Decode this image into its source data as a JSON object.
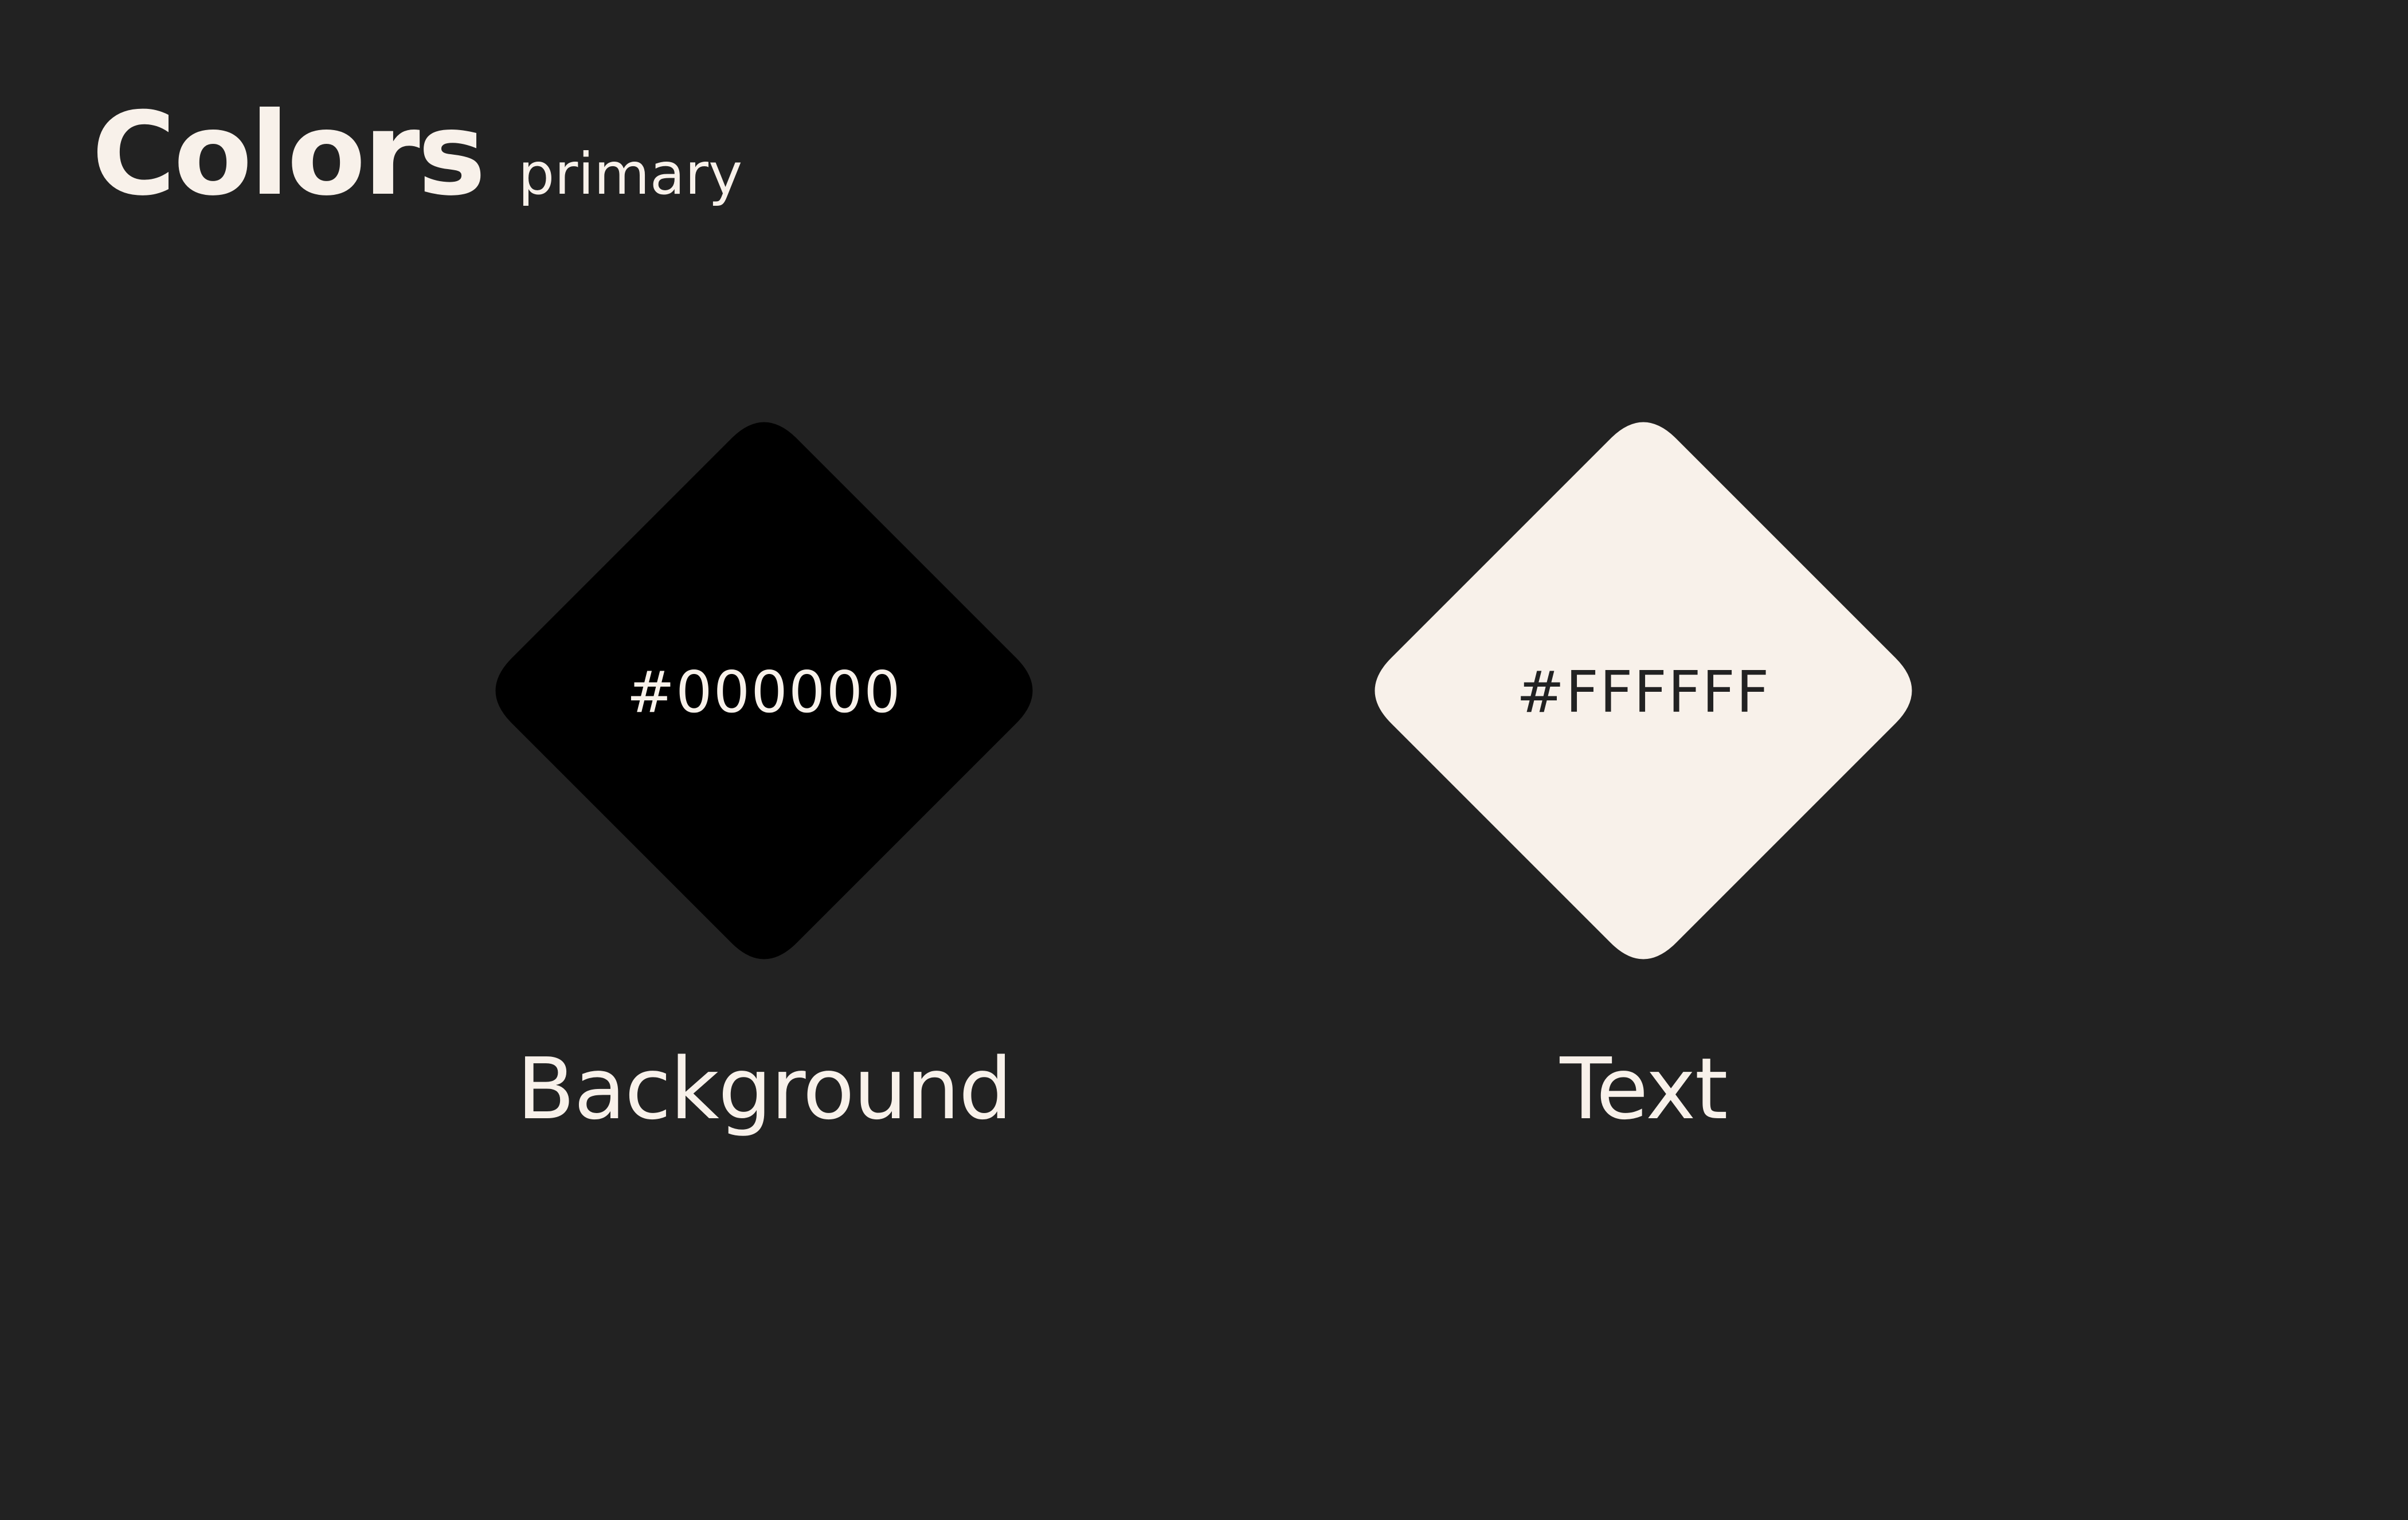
{
  "heading": {
    "title": "Colors",
    "subtitle": "primary"
  },
  "swatches": [
    {
      "hex": "#000000",
      "label": "Background",
      "fill": "#000000",
      "text_color": "#f8f1ea"
    },
    {
      "hex": "#FFFFFF",
      "label": "Text",
      "fill": "#f8f1ea",
      "text_color": "#222222"
    }
  ],
  "colors": {
    "page_background": "#222222",
    "foreground": "#f8f1ea"
  }
}
